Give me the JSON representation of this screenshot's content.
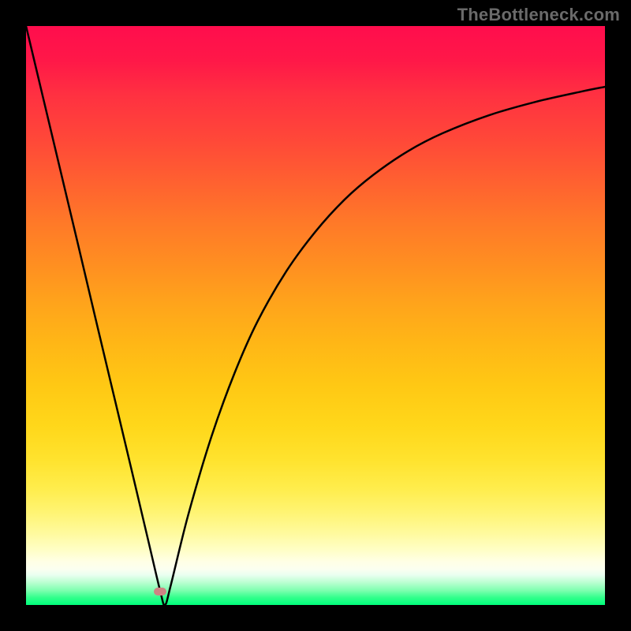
{
  "attribution": "TheBottleneck.com",
  "chart_data": {
    "type": "line",
    "title": "",
    "xlabel": "",
    "ylabel": "",
    "xlim": [
      0,
      100
    ],
    "ylim": [
      0,
      100
    ],
    "x": [
      0,
      3,
      6,
      9,
      12,
      15,
      18,
      21,
      23.2,
      24,
      25,
      28,
      32,
      36,
      40,
      45,
      50,
      55,
      60,
      66,
      72,
      80,
      88,
      96,
      100
    ],
    "values": [
      100,
      87.4,
      74.8,
      62.2,
      49.5,
      36.9,
      24.3,
      11.6,
      2.3,
      0.0,
      3.4,
      15.5,
      29.0,
      40.0,
      49.0,
      57.7,
      64.5,
      70.0,
      74.3,
      78.4,
      81.5,
      84.6,
      86.9,
      88.7,
      89.5
    ],
    "marker": {
      "x": 23.2,
      "y": 2.3
    },
    "background_gradient": {
      "top": "#ff0d4d",
      "mid_orange": "#ff8e21",
      "mid_yellow": "#ffe32e",
      "pale_yellow": "#fffec6",
      "green": "#00ff7c"
    }
  }
}
